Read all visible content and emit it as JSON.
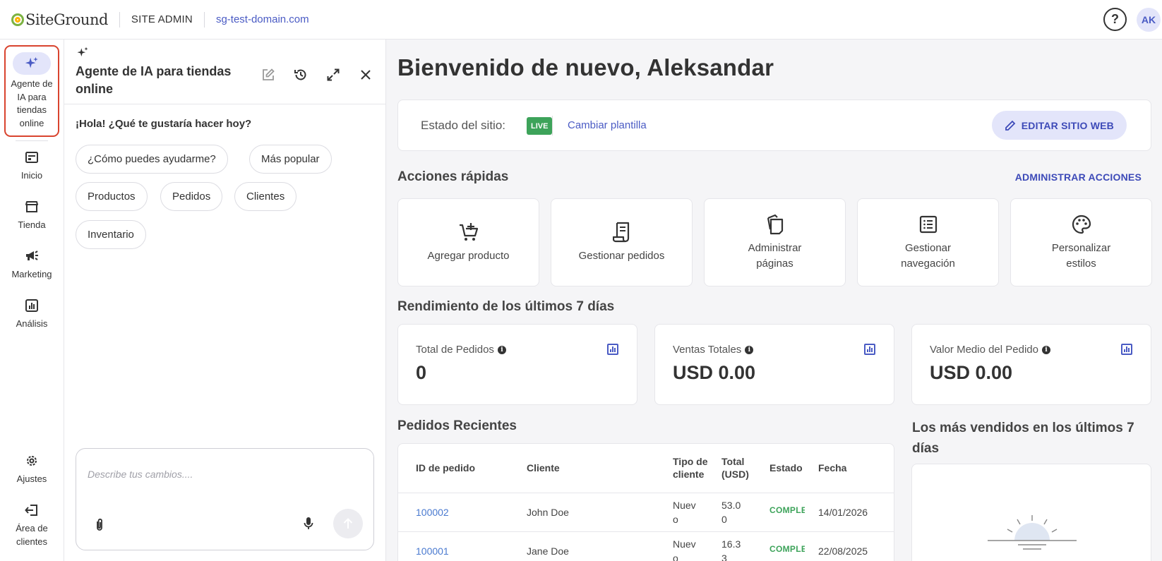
{
  "topbar": {
    "logo_text": "SiteGround",
    "site_admin": "SITE ADMIN",
    "domain": "sg-test-domain.com",
    "help_label": "?",
    "avatar_initials": "AK"
  },
  "leftnav": {
    "ai_agent_label": "Agente de IA para tiendas online",
    "items": [
      {
        "label": "Inicio",
        "icon": "home-icon"
      },
      {
        "label": "Tienda",
        "icon": "store-icon"
      },
      {
        "label": "Marketing",
        "icon": "megaphone-icon"
      },
      {
        "label": "Análisis",
        "icon": "analytics-icon"
      }
    ],
    "bottom_items": [
      {
        "label": "Ajustes",
        "icon": "gear-icon"
      },
      {
        "label": "Área de clientes",
        "icon": "logout-icon"
      }
    ]
  },
  "chat": {
    "title": "Agente de IA para tiendas online",
    "greeting": "¡Hola! ¿Qué te gustaría hacer hoy?",
    "chips": [
      "¿Cómo puedes ayudarme?",
      "Más popular",
      "Productos",
      "Pedidos",
      "Clientes",
      "Inventario"
    ],
    "input_placeholder": "Describe tus cambios...."
  },
  "main": {
    "welcome": "Bienvenido de nuevo, Aleksandar",
    "status_label": "Estado del sitio:",
    "status_badge": "LIVE",
    "change_template": "Cambiar plantilla",
    "edit_site": "EDITAR SITIO WEB",
    "quick_actions_title": "Acciones rápidas",
    "manage_actions": "ADMINISTRAR ACCIONES",
    "quick_actions": [
      {
        "label": "Agregar producto",
        "icon": "add-cart-icon"
      },
      {
        "label": "Gestionar pedidos",
        "icon": "receipt-icon"
      },
      {
        "label": "Administrar páginas",
        "icon": "pages-icon"
      },
      {
        "label": "Gestionar navegación",
        "icon": "list-icon"
      },
      {
        "label": "Personalizar estilos",
        "icon": "palette-icon"
      }
    ],
    "performance_title": "Rendimiento de los últimos 7 días",
    "stats": [
      {
        "label": "Total de Pedidos",
        "value": "0"
      },
      {
        "label": "Ventas Totales",
        "value": "USD 0.00"
      },
      {
        "label": "Valor Medio del Pedido",
        "value": "USD 0.00"
      }
    ],
    "recent_orders_title": "Pedidos Recientes",
    "orders_headers": [
      "ID de pedido",
      "Cliente",
      "Tipo de cliente",
      "Total (USD)",
      "Estado",
      "Fecha"
    ],
    "orders": [
      {
        "id": "100002",
        "customer": "John Doe",
        "type": "Nuevo",
        "total": "53.00",
        "status": "COMPLETADO",
        "date": "14/01/2026"
      },
      {
        "id": "100001",
        "customer": "Jane Doe",
        "type": "Nuevo",
        "total": "16.33",
        "status": "COMPLETADO",
        "date": "22/08/2025"
      }
    ],
    "bestsellers_title": "Los más vendidos en los últimos 7 días"
  },
  "colors": {
    "accent": "#4a5bc4",
    "live": "#3da35a",
    "highlight_border": "#d9442f"
  }
}
